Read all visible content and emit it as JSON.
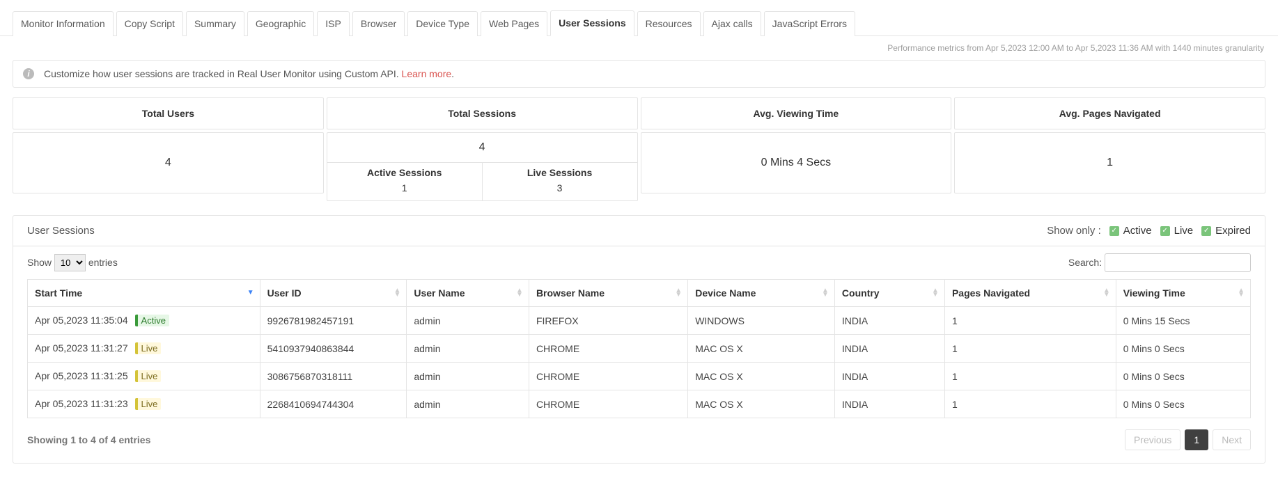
{
  "tabs": {
    "monitor_info": "Monitor Information",
    "copy_script": "Copy Script",
    "summary": "Summary",
    "geographic": "Geographic",
    "isp": "ISP",
    "browser": "Browser",
    "device_type": "Device Type",
    "web_pages": "Web Pages",
    "user_sessions": "User Sessions",
    "resources": "Resources",
    "ajax_calls": "Ajax calls",
    "js_errors": "JavaScript Errors"
  },
  "perf_line": "Performance metrics from Apr 5,2023 12:00 AM to Apr 5,2023 11:36 AM with 1440 minutes granularity",
  "info_banner": {
    "text": "Customize how user sessions are tracked in Real User Monitor using Custom API. ",
    "link": "Learn more",
    "suffix": "."
  },
  "metrics": {
    "total_users": {
      "label": "Total Users",
      "value": "4"
    },
    "total_sessions": {
      "label": "Total Sessions",
      "total": "4",
      "active_label": "Active Sessions",
      "active_value": "1",
      "live_label": "Live Sessions",
      "live_value": "3"
    },
    "avg_viewing": {
      "label": "Avg. Viewing Time",
      "value": "0 Mins 4 Secs"
    },
    "avg_pages": {
      "label": "Avg. Pages Navigated",
      "value": "1"
    }
  },
  "sessions_section": {
    "title": "User Sessions",
    "show_only_label": "Show only :",
    "filters": {
      "active": "Active",
      "live": "Live",
      "expired": "Expired"
    }
  },
  "list_controls": {
    "show_prefix": "Show",
    "show_suffix": "entries",
    "page_size": "10",
    "search_label": "Search:"
  },
  "columns": {
    "start_time": "Start Time",
    "user_id": "User ID",
    "user_name": "User Name",
    "browser_name": "Browser Name",
    "device_name": "Device Name",
    "country": "Country",
    "pages_nav": "Pages Navigated",
    "viewing_time": "Viewing Time"
  },
  "rows": [
    {
      "start": "Apr 05,2023 11:35:04",
      "status": "Active",
      "user_id": "9926781982457191",
      "user_name": "admin",
      "browser": "FIREFOX",
      "device": "WINDOWS",
      "country": "INDIA",
      "pages": "1",
      "viewing": "0 Mins 15 Secs"
    },
    {
      "start": "Apr 05,2023 11:31:27",
      "status": "Live",
      "user_id": "5410937940863844",
      "user_name": "admin",
      "browser": "CHROME",
      "device": "MAC OS X",
      "country": "INDIA",
      "pages": "1",
      "viewing": "0 Mins 0 Secs"
    },
    {
      "start": "Apr 05,2023 11:31:25",
      "status": "Live",
      "user_id": "3086756870318111",
      "user_name": "admin",
      "browser": "CHROME",
      "device": "MAC OS X",
      "country": "INDIA",
      "pages": "1",
      "viewing": "0 Mins 0 Secs"
    },
    {
      "start": "Apr 05,2023 11:31:23",
      "status": "Live",
      "user_id": "2268410694744304",
      "user_name": "admin",
      "browser": "CHROME",
      "device": "MAC OS X",
      "country": "INDIA",
      "pages": "1",
      "viewing": "0 Mins 0 Secs"
    }
  ],
  "footer": {
    "summary": "Showing 1 to 4 of 4 entries",
    "prev": "Previous",
    "page": "1",
    "next": "Next"
  }
}
